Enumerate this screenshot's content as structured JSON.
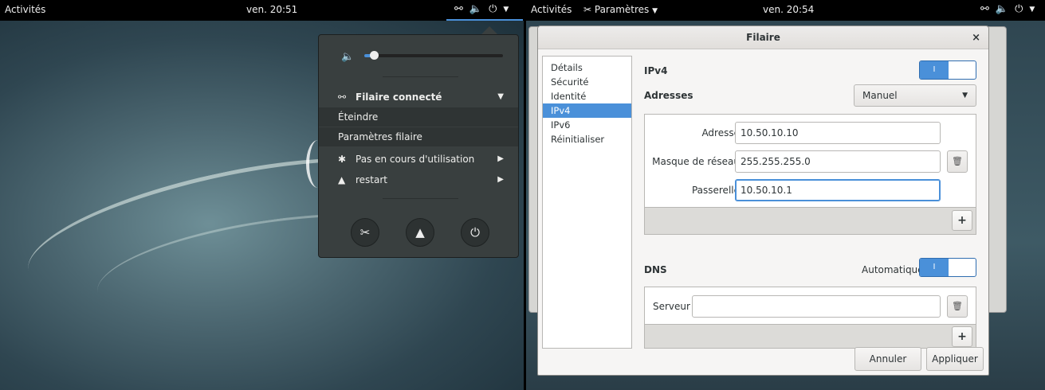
{
  "left_screen": {
    "topbar": {
      "activities": "Activités",
      "clock": "ven. 20:51",
      "icons": [
        "network-icon",
        "volume-icon",
        "power-icon",
        "dropdown-icon"
      ]
    },
    "menu": {
      "volume_level": 0.07,
      "wired": {
        "label": "Filaire connecté",
        "items": [
          "Éteindre",
          "Paramètres filaire"
        ]
      },
      "bluetooth": {
        "label": "Pas en cours d'utilisation"
      },
      "user": {
        "label": "restart"
      },
      "system_buttons": [
        "settings-icon",
        "lock-icon",
        "power-icon"
      ]
    }
  },
  "right_screen": {
    "topbar": {
      "activities": "Activités",
      "app_menu": "Paramètres",
      "clock": "ven. 20:54"
    },
    "dialog": {
      "title": "Filaire",
      "close": "×",
      "nav": [
        "Détails",
        "Sécurité",
        "Identité",
        "IPv4",
        "IPv6",
        "Réinitialiser"
      ],
      "selected_nav": "IPv4",
      "ipv4_label": "IPv4",
      "ipv4_switch_on": "I",
      "addresses_label": "Adresses",
      "method": "Manuel",
      "fields": {
        "address_label": "Adresse",
        "address_value": "10.50.10.10",
        "netmask_label": "Masque de réseau",
        "netmask_value": "255.255.255.0",
        "gateway_label": "Passerelle",
        "gateway_value": "10.50.10.1"
      },
      "plus": "+",
      "dns_label": "DNS",
      "dns_auto_label": "Automatique",
      "dns_switch_on": "I",
      "server_label": "Serveur",
      "server_value": "",
      "cancel": "Annuler",
      "apply": "Appliquer"
    }
  }
}
